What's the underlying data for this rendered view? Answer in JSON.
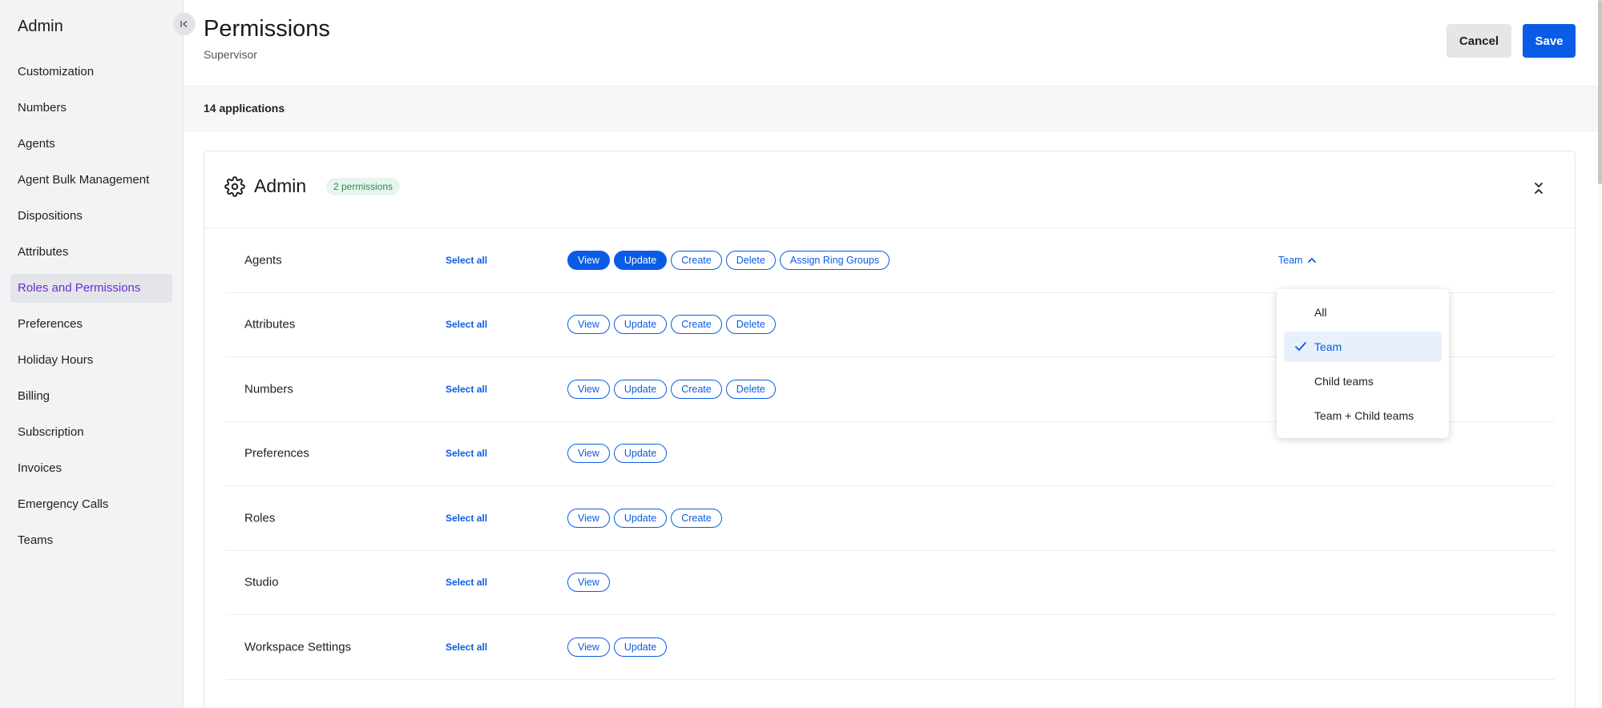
{
  "sidebar": {
    "title": "Admin",
    "items": [
      {
        "label": "Customization"
      },
      {
        "label": "Numbers"
      },
      {
        "label": "Agents"
      },
      {
        "label": "Agent Bulk Management"
      },
      {
        "label": "Dispositions"
      },
      {
        "label": "Attributes"
      },
      {
        "label": "Roles and Permissions",
        "active": true
      },
      {
        "label": "Preferences"
      },
      {
        "label": "Holiday Hours"
      },
      {
        "label": "Billing"
      },
      {
        "label": "Subscription"
      },
      {
        "label": "Invoices"
      },
      {
        "label": "Emergency Calls"
      },
      {
        "label": "Teams"
      }
    ]
  },
  "header": {
    "title": "Permissions",
    "subtitle": "Supervisor",
    "cancel_label": "Cancel",
    "save_label": "Save"
  },
  "summary": {
    "count_label": "14 applications"
  },
  "card": {
    "title": "Admin",
    "badge": "2 permissions",
    "select_all_label": "Select all",
    "rows": [
      {
        "label": "Agents",
        "actions": [
          "View",
          "Update",
          "Create",
          "Delete",
          "Assign Ring Groups"
        ],
        "active": [
          "View",
          "Update"
        ],
        "scope": "Team"
      },
      {
        "label": "Attributes",
        "actions": [
          "View",
          "Update",
          "Create",
          "Delete"
        ],
        "active": []
      },
      {
        "label": "Numbers",
        "actions": [
          "View",
          "Update",
          "Create",
          "Delete"
        ],
        "active": []
      },
      {
        "label": "Preferences",
        "actions": [
          "View",
          "Update"
        ],
        "active": []
      },
      {
        "label": "Roles",
        "actions": [
          "View",
          "Update",
          "Create"
        ],
        "active": []
      },
      {
        "label": "Studio",
        "actions": [
          "View"
        ],
        "active": []
      },
      {
        "label": "Workspace Settings",
        "actions": [
          "View",
          "Update"
        ],
        "active": []
      }
    ]
  },
  "scope_dropdown": {
    "options": [
      "All",
      "Team",
      "Child teams",
      "Team + Child teams"
    ],
    "selected": "Team"
  },
  "colors": {
    "primary": "#0a5ce6",
    "active_nav": "#6b2bd9",
    "badge_bg": "#e8f5ec",
    "badge_text": "#2b8a4f"
  },
  "icons": {
    "collapse_sidebar": "collapse-left-icon",
    "section": "gear-icon",
    "collapse_section": "collapse-vertical-icon",
    "scope_toggle": "chevron-up-icon",
    "selected_option": "check-icon"
  }
}
